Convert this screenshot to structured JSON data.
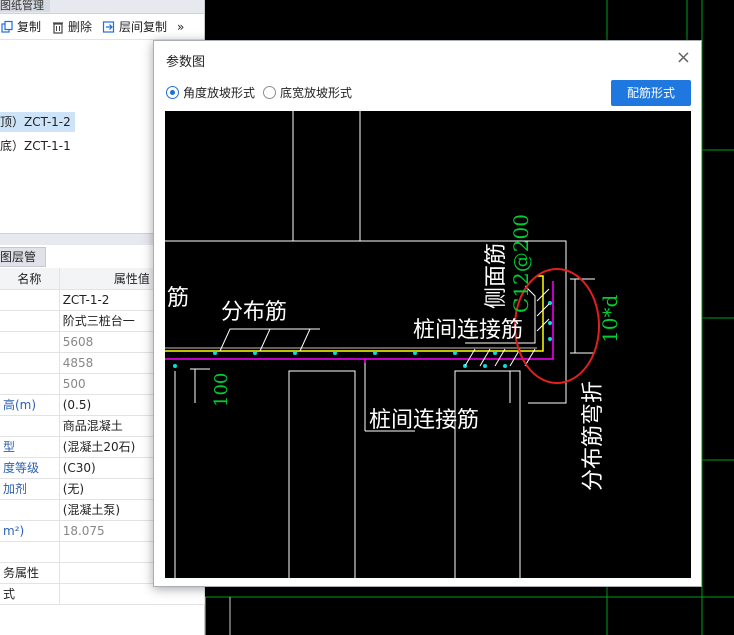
{
  "left_panel": {
    "header_label": "图纸管理",
    "toolbar": {
      "copy_label": "复制",
      "delete_label": "删除",
      "layer_copy_label": "层间复制",
      "more_label": "»"
    },
    "tree": [
      {
        "label": "顶）ZCT-1-2",
        "selected": true
      },
      {
        "label": "底）ZCT-1-1",
        "selected": false
      }
    ],
    "layer_tab_label": "图层管理",
    "prop_headers": {
      "name": "名称",
      "value": "属性值"
    },
    "properties": [
      {
        "key": "",
        "value": "ZCT-1-2",
        "value_gray": false,
        "key_plain": true
      },
      {
        "key": "",
        "value": "阶式三桩台一",
        "value_gray": false,
        "key_plain": true
      },
      {
        "key": "",
        "value": "5608",
        "value_gray": true,
        "key_plain": false
      },
      {
        "key": "",
        "value": "4858",
        "value_gray": true,
        "key_plain": false
      },
      {
        "key": "",
        "value": "500",
        "value_gray": true,
        "key_plain": false
      },
      {
        "key": "高(m)",
        "value": "(0.5)",
        "value_gray": false,
        "key_plain": false
      },
      {
        "key": "",
        "value": "商品混凝土",
        "value_gray": false,
        "key_plain": true
      },
      {
        "key": "型",
        "value": "(混凝土20石)",
        "value_gray": false,
        "key_plain": false
      },
      {
        "key": "度等级",
        "value": "(C30)",
        "value_gray": false,
        "key_plain": false
      },
      {
        "key": "加剂",
        "value": "(无)",
        "value_gray": false,
        "key_plain": false
      },
      {
        "key": "",
        "value": "(混凝土泵)",
        "value_gray": false,
        "key_plain": true
      },
      {
        "key": "m²)",
        "value": "18.075",
        "value_gray": true,
        "key_plain": false
      },
      {
        "key": "",
        "value": "",
        "value_gray": false,
        "key_plain": true
      },
      {
        "key": "务属性",
        "value": "",
        "value_gray": false,
        "key_plain": true
      },
      {
        "key": "式",
        "value": "",
        "value_gray": false,
        "key_plain": true
      }
    ]
  },
  "dialog": {
    "title": "参数图",
    "close_label": "×",
    "radio_angle_label": "角度放坡形式",
    "radio_width_label": "底宽放坡形式",
    "selected_radio": "angle",
    "config_button_label": "配筋形式",
    "accent_color": "#1e78e0"
  },
  "drawing": {
    "labels": {
      "distribution_left": "筋",
      "distribution": "分布筋",
      "pile_connect_top": "桩间连接筋",
      "pile_connect_bottom": "桩间连接筋",
      "side_face": "侧面筋",
      "side_spec": "C12@200",
      "bend_length": "10*d",
      "dim_100": "100",
      "distribution_bend": "分布筋弯折"
    },
    "colors": {
      "rebar_yellow": "#ffff00",
      "rebar_magenta": "#ff00ff",
      "dim_green": "#00cc33",
      "outline_white": "#ffffff",
      "highlight_red": "#e02020"
    }
  }
}
